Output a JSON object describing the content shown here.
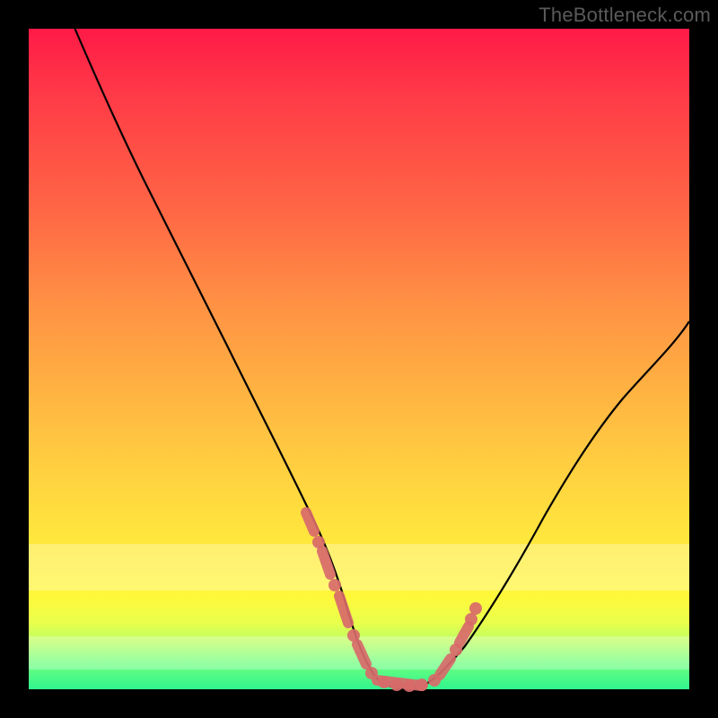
{
  "watermark": "TheBottleneck.com",
  "colors": {
    "marker": "#d86a6a",
    "line": "#000000",
    "frame": "#000000"
  },
  "chart_data": {
    "type": "line",
    "title": "",
    "xlabel": "",
    "ylabel": "",
    "xlim": [
      0,
      100
    ],
    "ylim": [
      0,
      100
    ],
    "grid": false,
    "legend": false,
    "series": [
      {
        "name": "curve",
        "x": [
          7,
          10,
          14,
          18,
          22,
          26,
          30,
          34,
          38,
          42,
          44,
          46,
          48,
          50,
          52,
          54,
          56,
          58,
          60,
          62,
          66,
          70,
          74,
          78,
          82,
          86,
          90,
          94,
          98,
          100
        ],
        "y": [
          100,
          93,
          84,
          76,
          68,
          60,
          52,
          44,
          36,
          27,
          22,
          17,
          12,
          7,
          3,
          1,
          0,
          0,
          0,
          1,
          4,
          9,
          15,
          22,
          29,
          36,
          43,
          49,
          54,
          56
        ]
      }
    ],
    "markers": {
      "name": "highlighted-points",
      "x": [
        42,
        43.5,
        44.5,
        46,
        48,
        50,
        52,
        54,
        56,
        58,
        60,
        62,
        63.5,
        64.5,
        65.5
      ],
      "y": [
        27,
        23,
        20,
        16,
        11,
        6,
        2.5,
        1,
        0,
        0,
        0.5,
        1.5,
        3,
        5,
        8
      ]
    },
    "bands": [
      {
        "name": "pale-band-upper",
        "y0": 78,
        "y1": 85
      },
      {
        "name": "pale-band-lower",
        "y0": 92,
        "y1": 97
      }
    ]
  }
}
